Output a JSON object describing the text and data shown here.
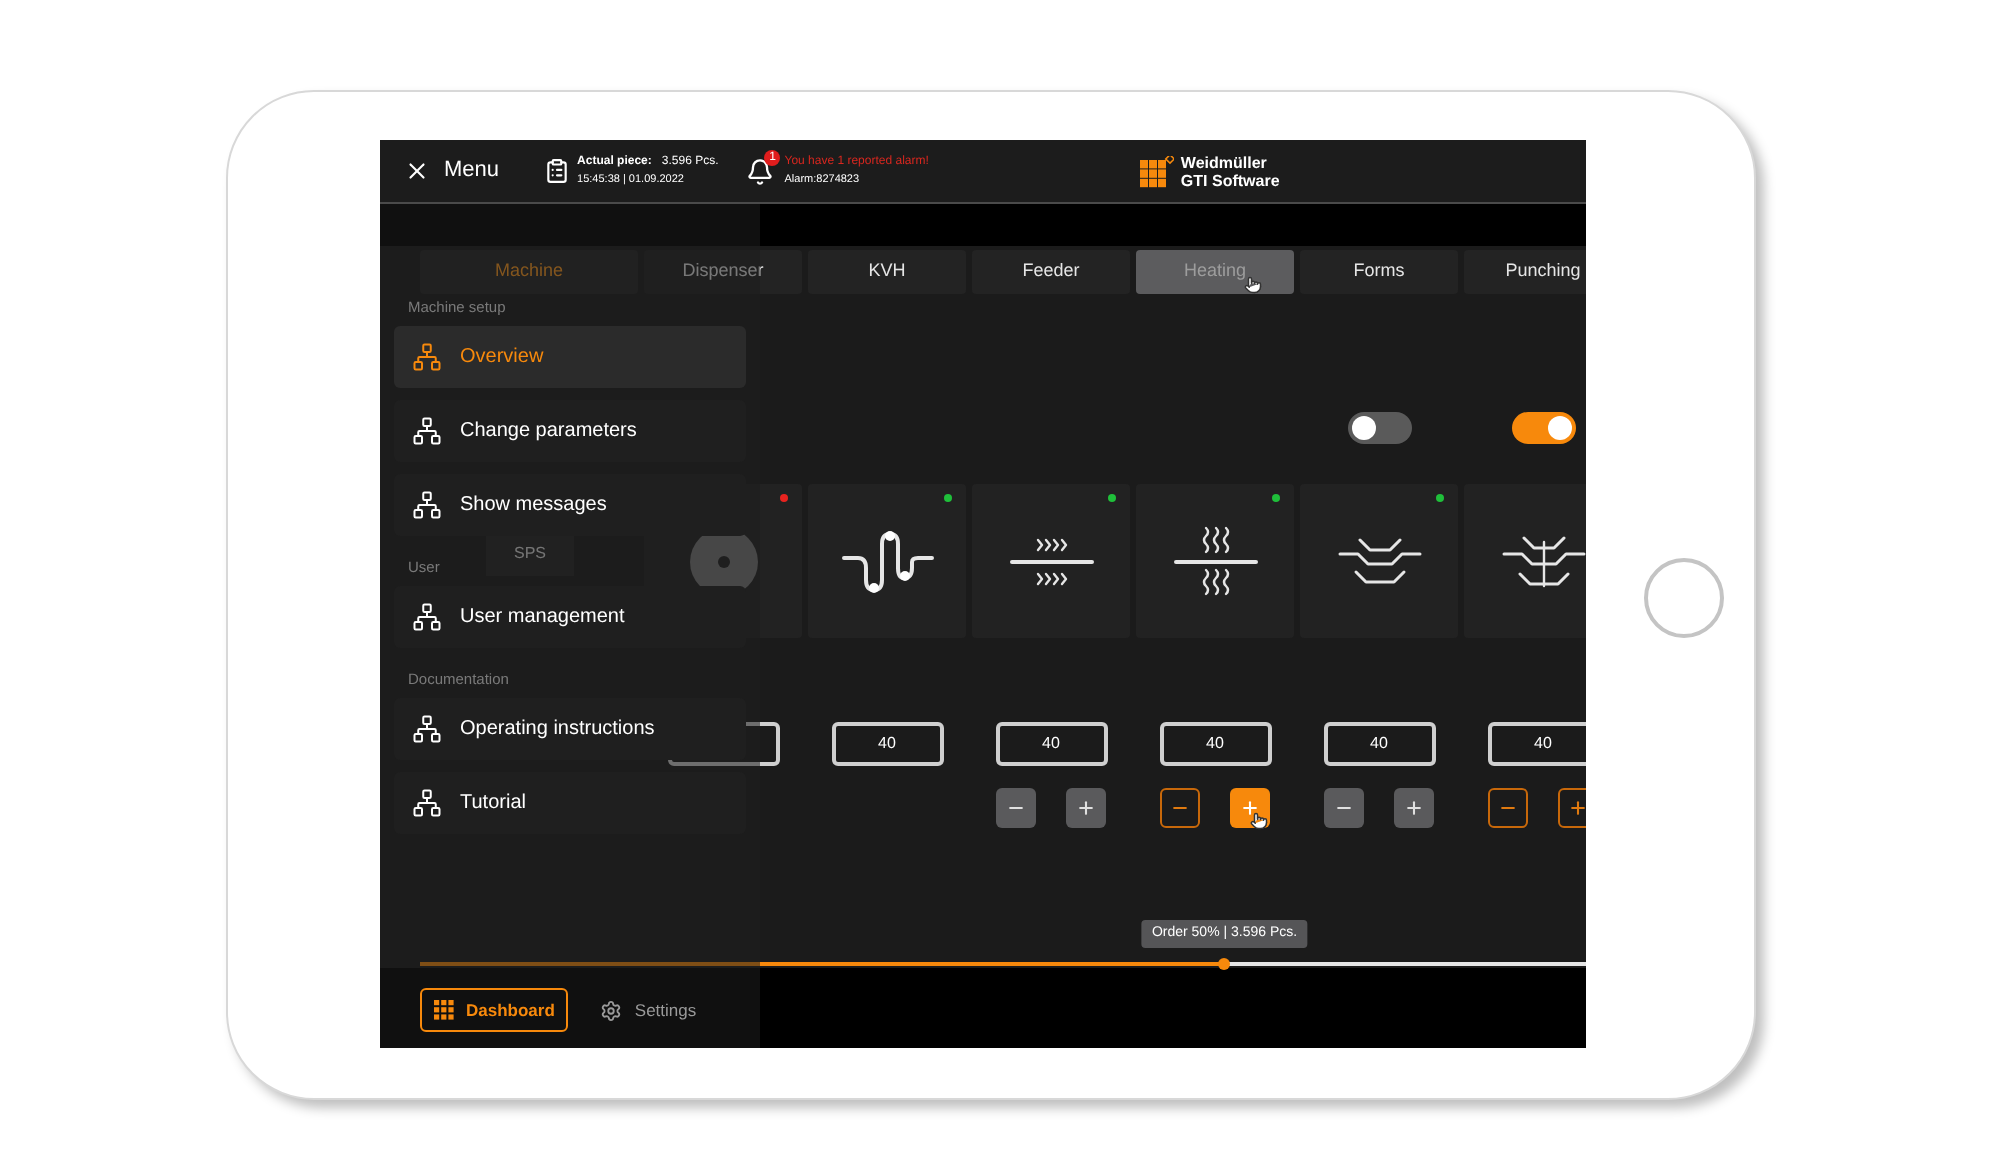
{
  "header": {
    "menu_label": "Menu",
    "piece_label": "Actual piece:",
    "piece_value": "3.596 Pcs.",
    "timestamp": "15:45:38 | 01.09.2022",
    "alarm_count": "1",
    "alarm_message": "You have 1 reported alarm!",
    "alarm_id": "Alarm:8274823",
    "logo_line1": "Weidmüller",
    "logo_line2": "GTI Software"
  },
  "tabs": [
    {
      "label": "Machine",
      "selected": true,
      "hovered": false
    },
    {
      "label": "Dispenser",
      "selected": false,
      "hovered": false
    },
    {
      "label": "KVH",
      "selected": false,
      "hovered": false
    },
    {
      "label": "Feeder",
      "selected": false,
      "hovered": false
    },
    {
      "label": "Heating",
      "selected": false,
      "hovered": true
    },
    {
      "label": "Forms",
      "selected": false,
      "hovered": false
    },
    {
      "label": "Punching",
      "selected": false,
      "hovered": false
    }
  ],
  "machine_cell": {
    "label": "SPS"
  },
  "stations": [
    {
      "kind": "disc",
      "color": "#e8231f"
    },
    {
      "kind": "wave",
      "color": "#1fbf3a",
      "value": "40"
    },
    {
      "kind": "chevrons",
      "color": "#1fbf3a",
      "value": "40",
      "steppers": {
        "accent": false,
        "plus_pressed": false
      }
    },
    {
      "kind": "heat",
      "color": "#1fbf3a",
      "value": "40",
      "steppers": {
        "accent": true,
        "plus_pressed": true
      }
    },
    {
      "kind": "forms",
      "color": "#1fbf3a",
      "value": "40",
      "steppers": {
        "accent": false,
        "plus_pressed": false
      },
      "toggle": {
        "on": false
      }
    },
    {
      "kind": "punch",
      "value": "40",
      "steppers": {
        "accent": true,
        "plus_pressed": false
      },
      "toggle": {
        "on": true
      }
    }
  ],
  "progress": {
    "tooltip": "Order 50% | 3.596 Pcs.",
    "level": 0.69
  },
  "menu": {
    "sections": [
      {
        "title": "Machine setup",
        "items": [
          {
            "label": "Overview",
            "selected": true
          },
          {
            "label": "Change parameters",
            "selected": false
          },
          {
            "label": "Show messages",
            "selected": false
          }
        ]
      },
      {
        "title": "User",
        "items": [
          {
            "label": "User management",
            "selected": false
          }
        ]
      },
      {
        "title": "Documentation",
        "items": [
          {
            "label": "Operating instructions",
            "selected": false
          },
          {
            "label": "Tutorial",
            "selected": false
          }
        ]
      }
    ],
    "footer": [
      {
        "kind": "dashboard",
        "label": "Dashboard",
        "selected": true
      },
      {
        "kind": "settings",
        "label": "Settings",
        "selected": false
      }
    ]
  }
}
